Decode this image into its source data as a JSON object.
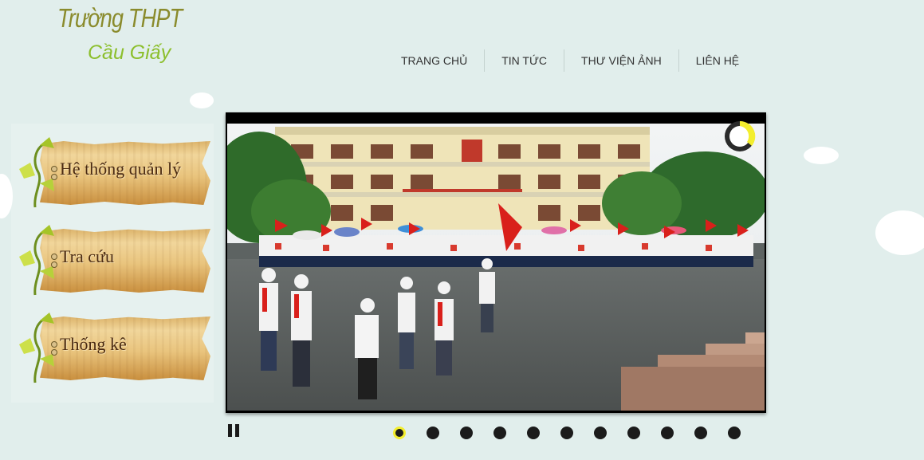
{
  "logo": {
    "line1": "Trường THPT",
    "line2": "Cầu Giấy"
  },
  "nav": {
    "items": [
      "TRANG CHỦ",
      "TIN TỨC",
      "THƯ VIỆN ẢNH",
      "LIÊN HỆ"
    ]
  },
  "sidebar": {
    "items": [
      {
        "label": "Hệ thống quản lý"
      },
      {
        "label": "Tra cứu"
      },
      {
        "label": "Thống kê"
      }
    ]
  },
  "slider": {
    "slide_count": 11,
    "active_index": 0,
    "colors": {
      "active_dot_ring": "#f3ee2e",
      "dot": "#1b1b1b",
      "loader_fill": "#f3ee2e"
    }
  },
  "icons": {
    "pause": "pause-icon",
    "loader": "loading-ring-icon",
    "leaf": "leaf-vine-icon"
  },
  "theme": {
    "background": "#e1eeec",
    "logo_primary": "#8a8b2c",
    "logo_secondary": "#8cbf2d"
  }
}
